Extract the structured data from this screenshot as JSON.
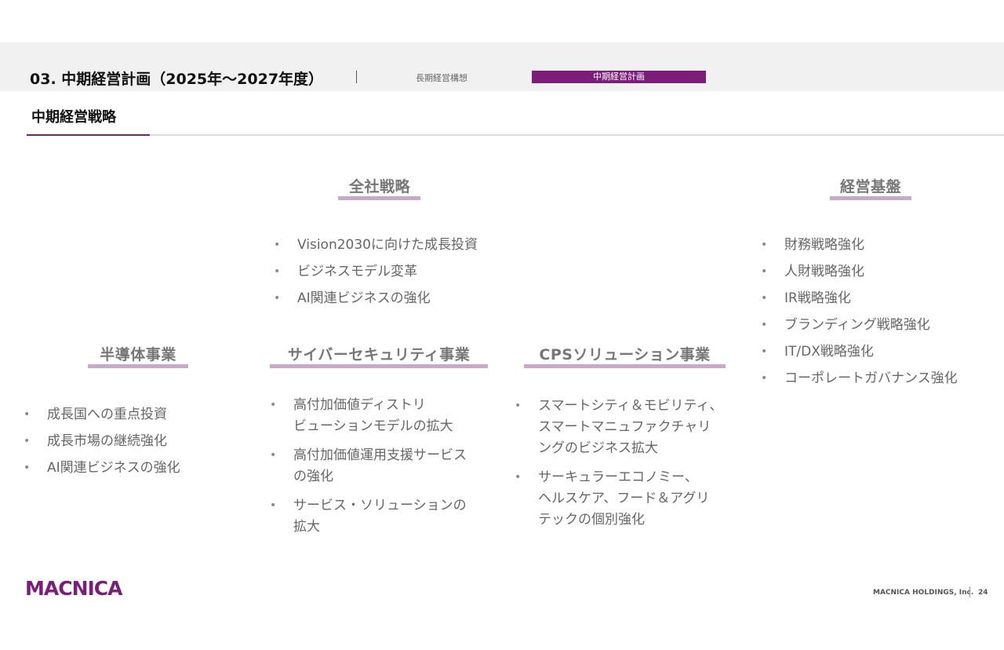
{
  "header": {
    "section_title": "03. 中期経営計画（2025年〜2027年度）",
    "tabs": [
      {
        "label": "長期経営構想",
        "active": false
      },
      {
        "label": "中期経営計画",
        "active": true
      }
    ],
    "page_heading": "中期経営戦略"
  },
  "colors": {
    "accent": "#7b1e7a",
    "underline": "#c9a8cc",
    "band": "#f1f1f1"
  },
  "sections": {
    "company_strategy": {
      "title": "全社戦略",
      "items": [
        "Vision2030に向けた成長投資",
        "ビジネスモデル変革",
        "AI関連ビジネスの強化"
      ]
    },
    "management_base": {
      "title": "経営基盤",
      "items": [
        "財務戦略強化",
        "人財戦略強化",
        "IR戦略強化",
        "ブランディング戦略強化",
        "IT/DX戦略強化",
        "コーポレートガバナンス強化"
      ]
    },
    "semiconductor": {
      "title": "半導体事業",
      "items": [
        "成長国への重点投資",
        "成長市場の継続強化",
        "AI関連ビジネスの強化"
      ]
    },
    "cybersecurity": {
      "title": "サイバーセキュリティ事業",
      "items": [
        "高付加価値ディストリ\nビューションモデルの拡大",
        "高付加価値運用支援サービス\nの強化",
        "サービス・ソリューションの\n拡大"
      ]
    },
    "cps": {
      "title": "CPSソリューション事業",
      "items": [
        "スマートシティ＆モビリティ、\nスマートマニュファクチャリ\nングのビジネス拡大",
        "サーキュラーエコノミー、\nヘルスケア、フード＆アグリ\nテックの個別強化"
      ]
    }
  },
  "footer": {
    "logo_text": "MACNICA",
    "company": "MACNICA HOLDINGS, Inc.",
    "page_number": "24"
  }
}
